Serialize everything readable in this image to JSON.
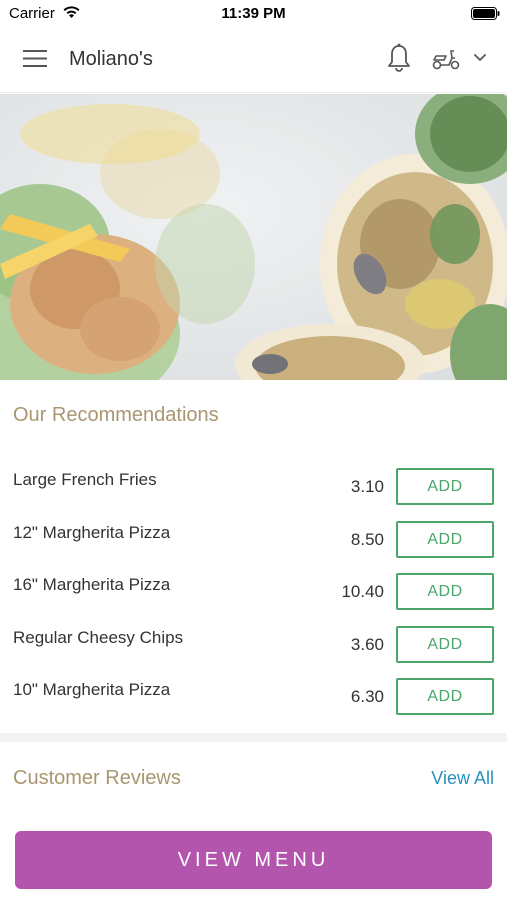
{
  "status_bar": {
    "carrier": "Carrier",
    "time": "11:39 PM"
  },
  "header": {
    "title": "Moliano's"
  },
  "recommendations": {
    "title": "Our Recommendations",
    "items": [
      {
        "name": "Large French Fries",
        "price": "3.10",
        "button": "ADD"
      },
      {
        "name": "12\" Margherita Pizza",
        "price": "8.50",
        "button": "ADD"
      },
      {
        "name": "16\" Margherita Pizza",
        "price": "10.40",
        "button": "ADD"
      },
      {
        "name": "Regular Cheesy Chips",
        "price": "3.60",
        "button": "ADD"
      },
      {
        "name": "10\" Margherita Pizza",
        "price": "6.30",
        "button": "ADD"
      }
    ]
  },
  "reviews": {
    "title": "Customer Reviews",
    "view_all": "View All"
  },
  "footer": {
    "view_menu": "VIEW MENU"
  },
  "icons": {
    "menu": "hamburger-menu-icon",
    "notifications": "bell-icon",
    "delivery": "scooter-icon",
    "dropdown": "chevron-down-icon"
  },
  "colors": {
    "accent_gold": "#a99671",
    "add_green": "#4aa66b",
    "link_blue": "#2a8fc1",
    "menu_purple": "#b355ad"
  }
}
